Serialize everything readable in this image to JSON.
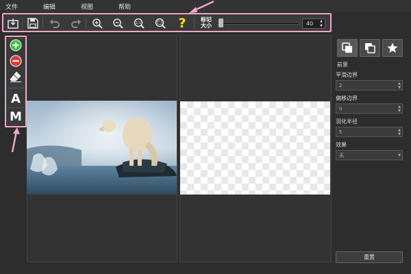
{
  "menu": [
    "文件",
    "编辑",
    "视图",
    "帮助"
  ],
  "toolbar": {
    "buttons": [
      "import-icon",
      "save-icon",
      "undo-icon",
      "redo-icon",
      "zoom-in-icon",
      "zoom-out-icon",
      "actual-size-icon",
      "fit-window-icon",
      "help-icon"
    ],
    "help_glyph": "?",
    "brush_label_line1": "标记",
    "brush_label_line2": "大小",
    "brush_size": "40",
    "brush_slider_value": 0.1
  },
  "tools": {
    "keep_icon": "plus-circle-icon",
    "remove_icon": "minus-circle-icon",
    "eraser_icon": "eraser-icon",
    "auto_label": "A",
    "manual_label": "M"
  },
  "right_panel": {
    "tabs": [
      "foreground-tab-icon",
      "background-tab-icon",
      "effects-tab-icon"
    ],
    "section_title": "前景",
    "smooth_label": "平滑边界",
    "smooth_value": "2",
    "offset_label": "偏移边界",
    "offset_value": "0",
    "feather_label": "羽化半径",
    "feather_value": "5",
    "effect_label": "效果",
    "effect_value": "无",
    "reset_label": "重置"
  },
  "colors": {
    "highlight_border": "#f2a6c8",
    "keep_green": "#3cbf3c",
    "remove_red": "#e03a3a",
    "help_yellow": "#ffe100"
  }
}
